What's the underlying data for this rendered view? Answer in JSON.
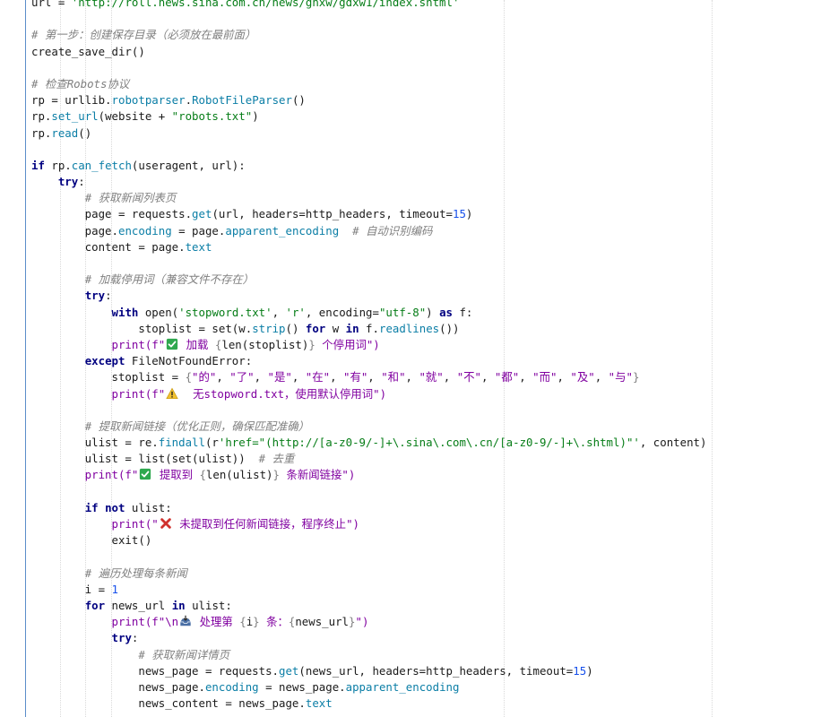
{
  "colors": {
    "keyword": "#000080",
    "string": "#067d17",
    "fstring": "#8000a0",
    "comment": "#808080",
    "number": "#1750eb",
    "attribute": "#0b7ea6",
    "gutter_line": "#5b8dc9"
  },
  "lines": [
    [
      {
        "t": "url = ",
        "c": ""
      },
      {
        "t": "'http://roll.news.sina.com.cn/news/gnxw/gdxw1/index.shtml'",
        "c": "str"
      }
    ],
    [],
    [
      {
        "t": "# 第一步：创建保存目录（必须放在最前面）",
        "c": "cmt"
      }
    ],
    [
      {
        "t": "create_save_dir()",
        "c": ""
      }
    ],
    [],
    [
      {
        "t": "# 检查Robots协议",
        "c": "cmt"
      }
    ],
    [
      {
        "t": "rp = urllib.",
        "c": ""
      },
      {
        "t": "robotparser",
        "c": "attr"
      },
      {
        "t": ".",
        "c": ""
      },
      {
        "t": "RobotFileParser",
        "c": "attr"
      },
      {
        "t": "()",
        "c": ""
      }
    ],
    [
      {
        "t": "rp.",
        "c": ""
      },
      {
        "t": "set_url",
        "c": "attr"
      },
      {
        "t": "(website + ",
        "c": ""
      },
      {
        "t": "\"robots.txt\"",
        "c": "str"
      },
      {
        "t": ")",
        "c": ""
      }
    ],
    [
      {
        "t": "rp.",
        "c": ""
      },
      {
        "t": "read",
        "c": "attr"
      },
      {
        "t": "()",
        "c": ""
      }
    ],
    [],
    [
      {
        "t": "if",
        "c": "kw"
      },
      {
        "t": " rp.",
        "c": ""
      },
      {
        "t": "can_fetch",
        "c": "attr"
      },
      {
        "t": "(useragent, url):",
        "c": ""
      }
    ],
    [
      {
        "t": "    ",
        "c": ""
      },
      {
        "t": "try",
        "c": "kw"
      },
      {
        "t": ":",
        "c": ""
      }
    ],
    [
      {
        "t": "        ",
        "c": ""
      },
      {
        "t": "# 获取新闻列表页",
        "c": "cmt"
      }
    ],
    [
      {
        "t": "        page = requests.",
        "c": ""
      },
      {
        "t": "get",
        "c": "attr"
      },
      {
        "t": "(url, headers=http_headers, timeout=",
        "c": ""
      },
      {
        "t": "15",
        "c": "num"
      },
      {
        "t": ")",
        "c": ""
      }
    ],
    [
      {
        "t": "        page.",
        "c": ""
      },
      {
        "t": "encoding",
        "c": "attr"
      },
      {
        "t": " = page.",
        "c": ""
      },
      {
        "t": "apparent_encoding",
        "c": "attr"
      },
      {
        "t": "  ",
        "c": ""
      },
      {
        "t": "# 自动识别编码",
        "c": "cmt"
      }
    ],
    [
      {
        "t": "        content = page.",
        "c": ""
      },
      {
        "t": "text",
        "c": "attr"
      }
    ],
    [],
    [
      {
        "t": "        ",
        "c": ""
      },
      {
        "t": "# 加载停用词（兼容文件不存在）",
        "c": "cmt"
      }
    ],
    [
      {
        "t": "        ",
        "c": ""
      },
      {
        "t": "try",
        "c": "kw"
      },
      {
        "t": ":",
        "c": ""
      }
    ],
    [
      {
        "t": "            ",
        "c": ""
      },
      {
        "t": "with",
        "c": "kw"
      },
      {
        "t": " open(",
        "c": ""
      },
      {
        "t": "'stopword.txt'",
        "c": "str"
      },
      {
        "t": ", ",
        "c": ""
      },
      {
        "t": "'r'",
        "c": "str"
      },
      {
        "t": ", encoding=",
        "c": ""
      },
      {
        "t": "\"utf-8\"",
        "c": "str"
      },
      {
        "t": ") ",
        "c": ""
      },
      {
        "t": "as",
        "c": "kw"
      },
      {
        "t": " f:",
        "c": ""
      }
    ],
    [
      {
        "t": "                stoplist = set(w.",
        "c": ""
      },
      {
        "t": "strip",
        "c": "attr"
      },
      {
        "t": "() ",
        "c": ""
      },
      {
        "t": "for",
        "c": "kw"
      },
      {
        "t": " w ",
        "c": ""
      },
      {
        "t": "in",
        "c": "kw"
      },
      {
        "t": " f.",
        "c": ""
      },
      {
        "t": "readlines",
        "c": "attr"
      },
      {
        "t": "())",
        "c": ""
      }
    ],
    [
      {
        "t": "            print(f\"",
        "c": "strp"
      },
      {
        "t": "check",
        "c": "emoji"
      },
      {
        "t": " 加载 ",
        "c": "strp"
      },
      {
        "t": "{",
        "c": "brace"
      },
      {
        "t": "len(stoplist)",
        "c": ""
      },
      {
        "t": "}",
        "c": "brace"
      },
      {
        "t": " 个停用词\")",
        "c": "strp"
      }
    ],
    [
      {
        "t": "        ",
        "c": ""
      },
      {
        "t": "except",
        "c": "kw"
      },
      {
        "t": " FileNotFoundError:",
        "c": ""
      }
    ],
    [
      {
        "t": "            stoplist = ",
        "c": ""
      },
      {
        "t": "{",
        "c": "brace"
      },
      {
        "t": "\"的\"",
        "c": "strp"
      },
      {
        "t": ", ",
        "c": ""
      },
      {
        "t": "\"了\"",
        "c": "strp"
      },
      {
        "t": ", ",
        "c": ""
      },
      {
        "t": "\"是\"",
        "c": "strp"
      },
      {
        "t": ", ",
        "c": ""
      },
      {
        "t": "\"在\"",
        "c": "strp"
      },
      {
        "t": ", ",
        "c": ""
      },
      {
        "t": "\"有\"",
        "c": "strp"
      },
      {
        "t": ", ",
        "c": ""
      },
      {
        "t": "\"和\"",
        "c": "strp"
      },
      {
        "t": ", ",
        "c": ""
      },
      {
        "t": "\"就\"",
        "c": "strp"
      },
      {
        "t": ", ",
        "c": ""
      },
      {
        "t": "\"不\"",
        "c": "strp"
      },
      {
        "t": ", ",
        "c": ""
      },
      {
        "t": "\"都\"",
        "c": "strp"
      },
      {
        "t": ", ",
        "c": ""
      },
      {
        "t": "\"而\"",
        "c": "strp"
      },
      {
        "t": ", ",
        "c": ""
      },
      {
        "t": "\"及\"",
        "c": "strp"
      },
      {
        "t": ", ",
        "c": ""
      },
      {
        "t": "\"与\"",
        "c": "strp"
      },
      {
        "t": "}",
        "c": "brace"
      }
    ],
    [
      {
        "t": "            print(f\"",
        "c": "strp"
      },
      {
        "t": "warning",
        "c": "emoji"
      },
      {
        "t": "  无stopword.txt，使用默认停用词\")",
        "c": "strp"
      }
    ],
    [],
    [
      {
        "t": "        ",
        "c": ""
      },
      {
        "t": "# 提取新闻链接（优化正则，确保匹配准确）",
        "c": "cmt"
      }
    ],
    [
      {
        "t": "        ulist = re.",
        "c": ""
      },
      {
        "t": "findall",
        "c": "attr"
      },
      {
        "t": "(r",
        "c": ""
      },
      {
        "t": "'href=\"(http://[a-z0-9/-]+\\.sina\\.com\\.cn/[a-z0-9/-]+\\.shtml)\"'",
        "c": "str"
      },
      {
        "t": ", content)",
        "c": ""
      }
    ],
    [
      {
        "t": "        ulist = list(set(ulist))  ",
        "c": ""
      },
      {
        "t": "# 去重",
        "c": "cmt"
      }
    ],
    [
      {
        "t": "        print(f\"",
        "c": "strp"
      },
      {
        "t": "check",
        "c": "emoji"
      },
      {
        "t": " 提取到 ",
        "c": "strp"
      },
      {
        "t": "{",
        "c": "brace"
      },
      {
        "t": "len(ulist)",
        "c": ""
      },
      {
        "t": "}",
        "c": "brace"
      },
      {
        "t": " 条新闻链接\")",
        "c": "strp"
      }
    ],
    [],
    [
      {
        "t": "        ",
        "c": ""
      },
      {
        "t": "if not",
        "c": "kw"
      },
      {
        "t": " ulist:",
        "c": ""
      }
    ],
    [
      {
        "t": "            print(\"",
        "c": "strp"
      },
      {
        "t": "cross",
        "c": "emoji"
      },
      {
        "t": " 未提取到任何新闻链接，程序终止\")",
        "c": "strp"
      }
    ],
    [
      {
        "t": "            exit()",
        "c": ""
      }
    ],
    [],
    [
      {
        "t": "        ",
        "c": ""
      },
      {
        "t": "# 遍历处理每条新闻",
        "c": "cmt"
      }
    ],
    [
      {
        "t": "        i = ",
        "c": ""
      },
      {
        "t": "1",
        "c": "num"
      }
    ],
    [
      {
        "t": "        ",
        "c": ""
      },
      {
        "t": "for",
        "c": "kw"
      },
      {
        "t": " news_url ",
        "c": ""
      },
      {
        "t": "in",
        "c": "kw"
      },
      {
        "t": " ulist:",
        "c": ""
      }
    ],
    [
      {
        "t": "            print(f\"\\n",
        "c": "strp"
      },
      {
        "t": "inbox",
        "c": "emoji"
      },
      {
        "t": " 处理第 ",
        "c": "strp"
      },
      {
        "t": "{",
        "c": "brace"
      },
      {
        "t": "i",
        "c": ""
      },
      {
        "t": "}",
        "c": "brace"
      },
      {
        "t": " 条：",
        "c": "strp"
      },
      {
        "t": "{",
        "c": "brace"
      },
      {
        "t": "news_url",
        "c": ""
      },
      {
        "t": "}",
        "c": "brace"
      },
      {
        "t": "\")",
        "c": "strp"
      }
    ],
    [
      {
        "t": "            ",
        "c": ""
      },
      {
        "t": "try",
        "c": "kw"
      },
      {
        "t": ":",
        "c": ""
      }
    ],
    [
      {
        "t": "                ",
        "c": ""
      },
      {
        "t": "# 获取新闻详情页",
        "c": "cmt"
      }
    ],
    [
      {
        "t": "                news_page = requests.",
        "c": ""
      },
      {
        "t": "get",
        "c": "attr"
      },
      {
        "t": "(news_url, headers=http_headers, timeout=",
        "c": ""
      },
      {
        "t": "15",
        "c": "num"
      },
      {
        "t": ")",
        "c": ""
      }
    ],
    [
      {
        "t": "                news_page.",
        "c": ""
      },
      {
        "t": "encoding",
        "c": "attr"
      },
      {
        "t": " = news_page.",
        "c": ""
      },
      {
        "t": "apparent_encoding",
        "c": "attr"
      }
    ],
    [
      {
        "t": "                news_content = news_page.",
        "c": ""
      },
      {
        "t": "text",
        "c": "attr"
      }
    ]
  ]
}
